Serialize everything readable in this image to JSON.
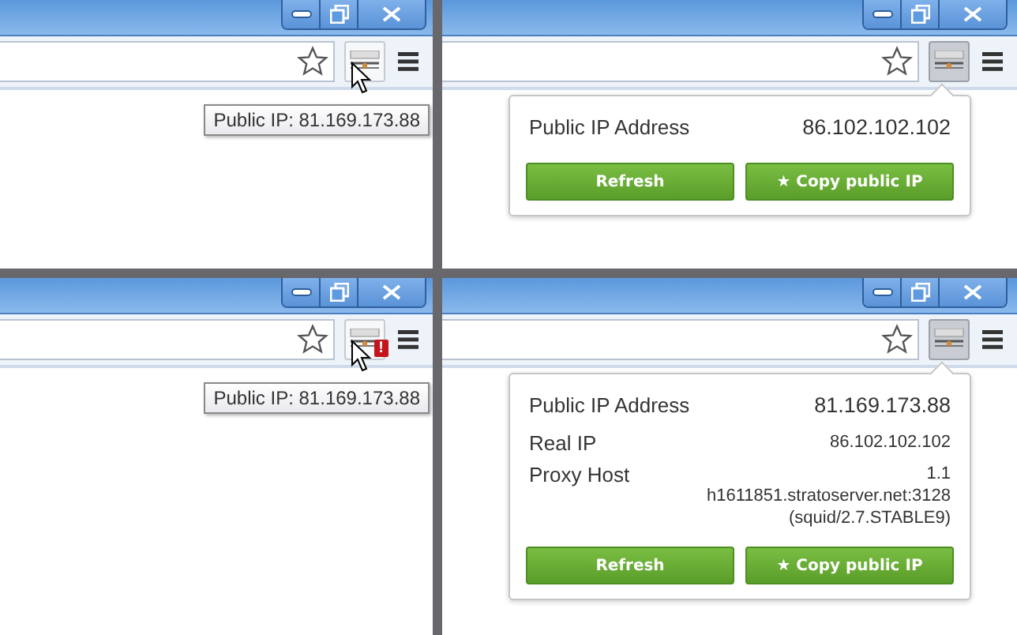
{
  "panels": [
    {
      "extension_button": {
        "pressed": false,
        "hovered": true
      },
      "tooltip": "Public IP: 81.169.173.88"
    },
    {
      "extension_button": {
        "pressed": true,
        "hovered": false
      },
      "popup": {
        "rows": [
          {
            "kind": "primary",
            "label": "Public IP Address",
            "value_lines": [
              "86.102.102.102"
            ]
          }
        ],
        "buttons": [
          "Refresh",
          "★ Copy public IP"
        ]
      }
    },
    {
      "extension_button": {
        "pressed": false,
        "hovered": true,
        "badge": "!"
      },
      "tooltip": "Public IP: 81.169.173.88"
    },
    {
      "extension_button": {
        "pressed": true,
        "hovered": false
      },
      "popup": {
        "rows": [
          {
            "kind": "primary",
            "label": "Public IP Address",
            "value_lines": [
              "81.169.173.88"
            ]
          },
          {
            "kind": "detail",
            "label": "Real IP",
            "value_lines": [
              "86.102.102.102"
            ]
          },
          {
            "kind": "detail",
            "label": "Proxy Host",
            "value_lines": [
              "1.1",
              "h1611851.stratoserver.net:3128",
              "(squid/2.7.STABLE9)"
            ]
          }
        ],
        "buttons": [
          "Refresh",
          "★ Copy public IP"
        ]
      }
    }
  ]
}
